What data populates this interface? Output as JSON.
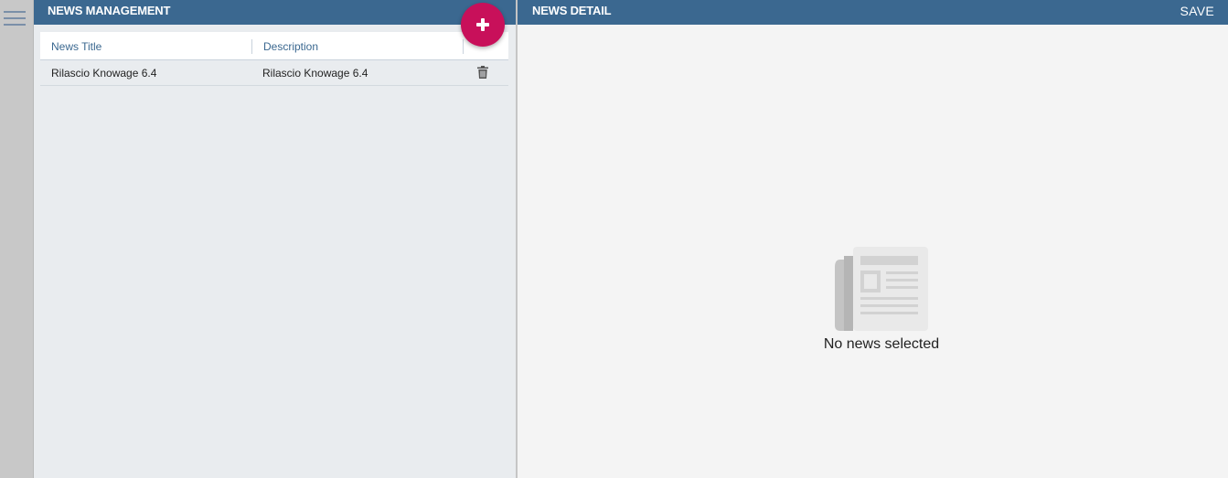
{
  "left_panel": {
    "title": "NEWS MANAGEMENT",
    "columns": [
      "News Title",
      "Description"
    ],
    "rows": [
      {
        "title": "Rilascio Knowage 6.4",
        "description": "Rilascio Knowage 6.4"
      }
    ]
  },
  "right_panel": {
    "title": "NEWS DETAIL",
    "save_label": "SAVE",
    "empty_message": "No news selected"
  },
  "icons": {
    "menu": "hamburger-menu-icon",
    "add": "plus-icon",
    "delete": "trash-icon",
    "empty": "newspaper-icon"
  },
  "colors": {
    "header": "#3b6890",
    "accent": "#c8105a",
    "column_header_text": "#3b6890"
  }
}
